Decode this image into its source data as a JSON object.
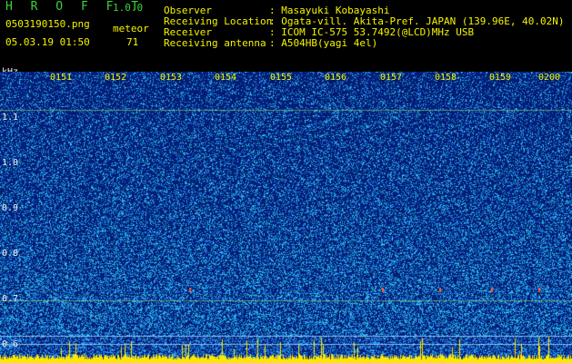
{
  "header": {
    "app_name": "H R O F F T",
    "version": "1.0.0",
    "filename": "0503190150.png",
    "mode": "meteor",
    "datetime": "05.03.19 01:50",
    "count": "71",
    "fields": [
      {
        "label": "Observer",
        "value": ": Masayuki Kobayashi"
      },
      {
        "label": "Receiving Location",
        "value": ": Ogata-vill. Akita-Pref. JAPAN (139.96E, 40.02N)"
      },
      {
        "label": "Receiver",
        "value": ": ICOM IC-575 53.7492(@LCD)MHz USB"
      },
      {
        "label": "Receiving antenna",
        "value": ": A504HB(yagi 4el)"
      }
    ]
  },
  "axis": {
    "unit": "kHz",
    "y_ticks": [
      "1.1",
      "1.0",
      "0.9",
      "0.8",
      "0.7",
      "0.6"
    ],
    "x_ticks": [
      "0151",
      "0152",
      "0153",
      "0154",
      "0155",
      "0156",
      "0157",
      "0158",
      "0159",
      "0200"
    ]
  },
  "colors": {
    "background": "#031a73",
    "label_green": "#3bd23b",
    "tick_yellow": "#f5f500",
    "power_bar": "#ffe600"
  }
}
